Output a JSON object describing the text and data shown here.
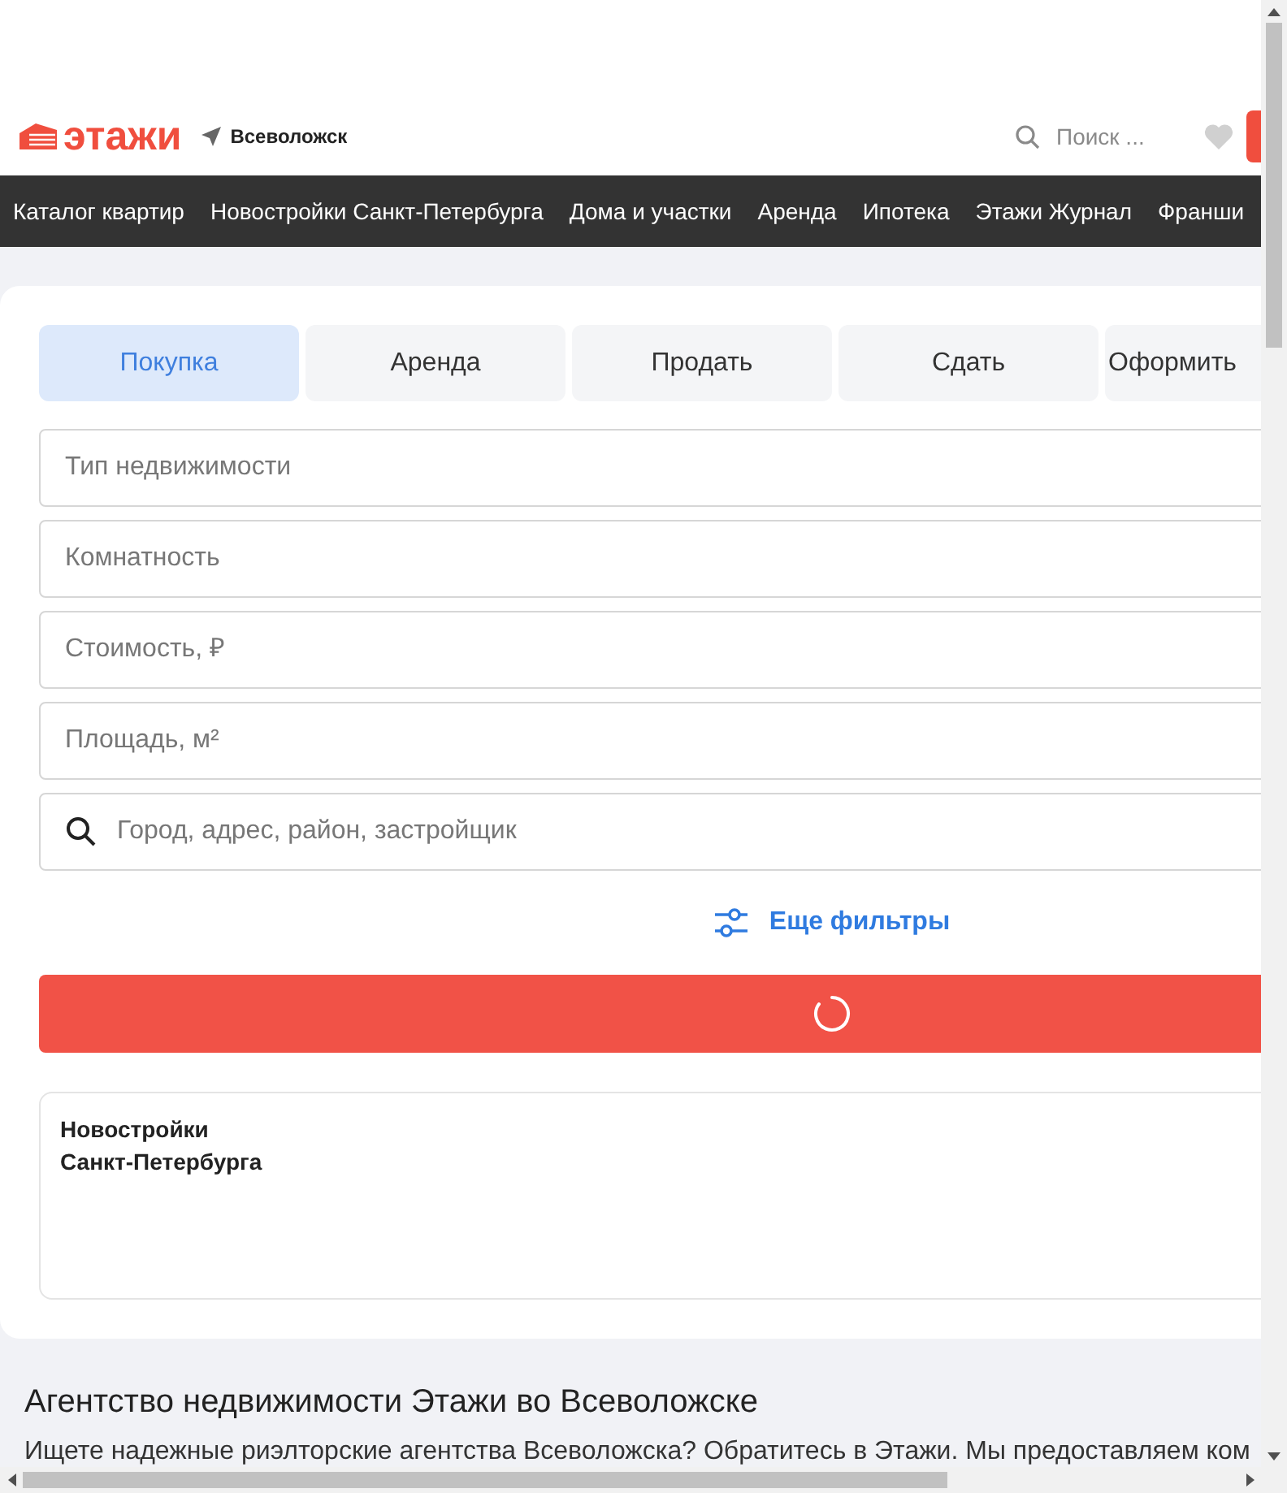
{
  "header": {
    "logo": "этажи",
    "location": "Всеволожск",
    "search": {
      "placeholder": "Поиск ..."
    }
  },
  "nav": [
    "Каталог квартир",
    "Новостройки Санкт-Петербурга",
    "Дома и участки",
    "Аренда",
    "Ипотека",
    "Этажи Журнал",
    "Франши"
  ],
  "tabs": [
    {
      "label": "Покупка",
      "selected": true
    },
    {
      "label": "Аренда",
      "selected": false
    },
    {
      "label": "Продать",
      "selected": false
    },
    {
      "label": "Сдать",
      "selected": false
    },
    {
      "label": "Оформить",
      "selected": false
    }
  ],
  "fields": [
    {
      "kind": "select",
      "placeholder": "Тип недвижимости"
    },
    {
      "kind": "select",
      "placeholder": "Комнатность"
    },
    {
      "kind": "select",
      "placeholder": "Стоимость, ₽"
    },
    {
      "kind": "select",
      "placeholder": "Площадь, м²"
    },
    {
      "kind": "search",
      "placeholder": "Город, адрес, район, застройщик"
    }
  ],
  "more_filters": "Еще фильтры",
  "submit": {
    "loading": true
  },
  "promo_card": {
    "title": "Новостройки\nСанкт-Петербурга"
  },
  "article": {
    "heading": "Агентство недвижимости Этажи во Всеволожске",
    "text": "Ищете надежные риэлторские агентства Всеволожска? Обратитесь в Этажи. Мы предоставляем ком"
  }
}
